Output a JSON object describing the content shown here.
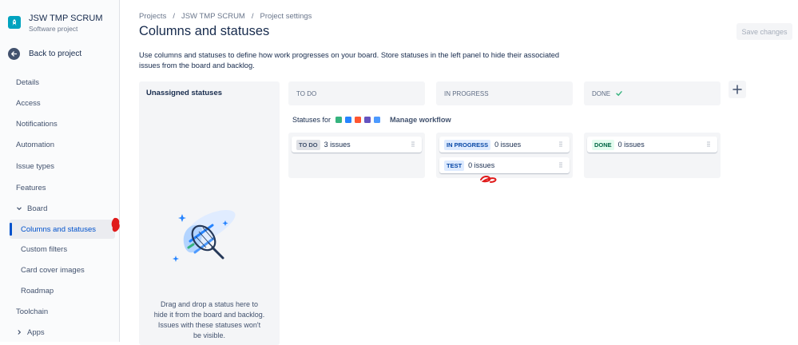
{
  "sidebar": {
    "project_name": "JSW TMP SCRUM",
    "project_type": "Software project",
    "back_label": "Back to project",
    "items": {
      "details": "Details",
      "access": "Access",
      "notifications": "Notifications",
      "automation": "Automation",
      "issue_types": "Issue types",
      "features": "Features",
      "board": "Board",
      "columns_statuses": "Columns and statuses",
      "custom_filters": "Custom filters",
      "card_cover": "Card cover images",
      "roadmap": "Roadmap",
      "toolchain": "Toolchain",
      "apps": "Apps"
    }
  },
  "breadcrumb": [
    "Projects",
    "JSW TMP SCRUM",
    "Project settings"
  ],
  "page": {
    "title": "Columns and statuses",
    "save_label": "Save changes",
    "description": "Use columns and statuses to define how work progresses on your board. Store statuses in the left panel to hide their associated issues from the board and backlog."
  },
  "unassigned": {
    "title": "Unassigned statuses",
    "drop_text": "Drag and drop a status here to hide it from the board and backlog. Issues with these statuses won't be visible."
  },
  "statuses_for": {
    "label": "Statuses for",
    "manage_label": "Manage workflow",
    "issue_type_colors": [
      "#36b37e",
      "#2684ff",
      "#ff5630",
      "#6554c0",
      "#4c9aff"
    ]
  },
  "columns": [
    {
      "header": "TO DO",
      "statuses": [
        {
          "name": "TO DO",
          "count": "3 issues"
        }
      ]
    },
    {
      "header": "IN PROGRESS",
      "statuses": [
        {
          "name": "IN PROGRESS",
          "count": "0 issues"
        },
        {
          "name": "TEST",
          "count": "0 issues"
        }
      ]
    },
    {
      "header": "DONE",
      "statuses": [
        {
          "name": "DONE",
          "count": "0 issues"
        }
      ]
    }
  ],
  "colors": {
    "accent": "#0052cc",
    "annotation": "#e01b1b"
  }
}
